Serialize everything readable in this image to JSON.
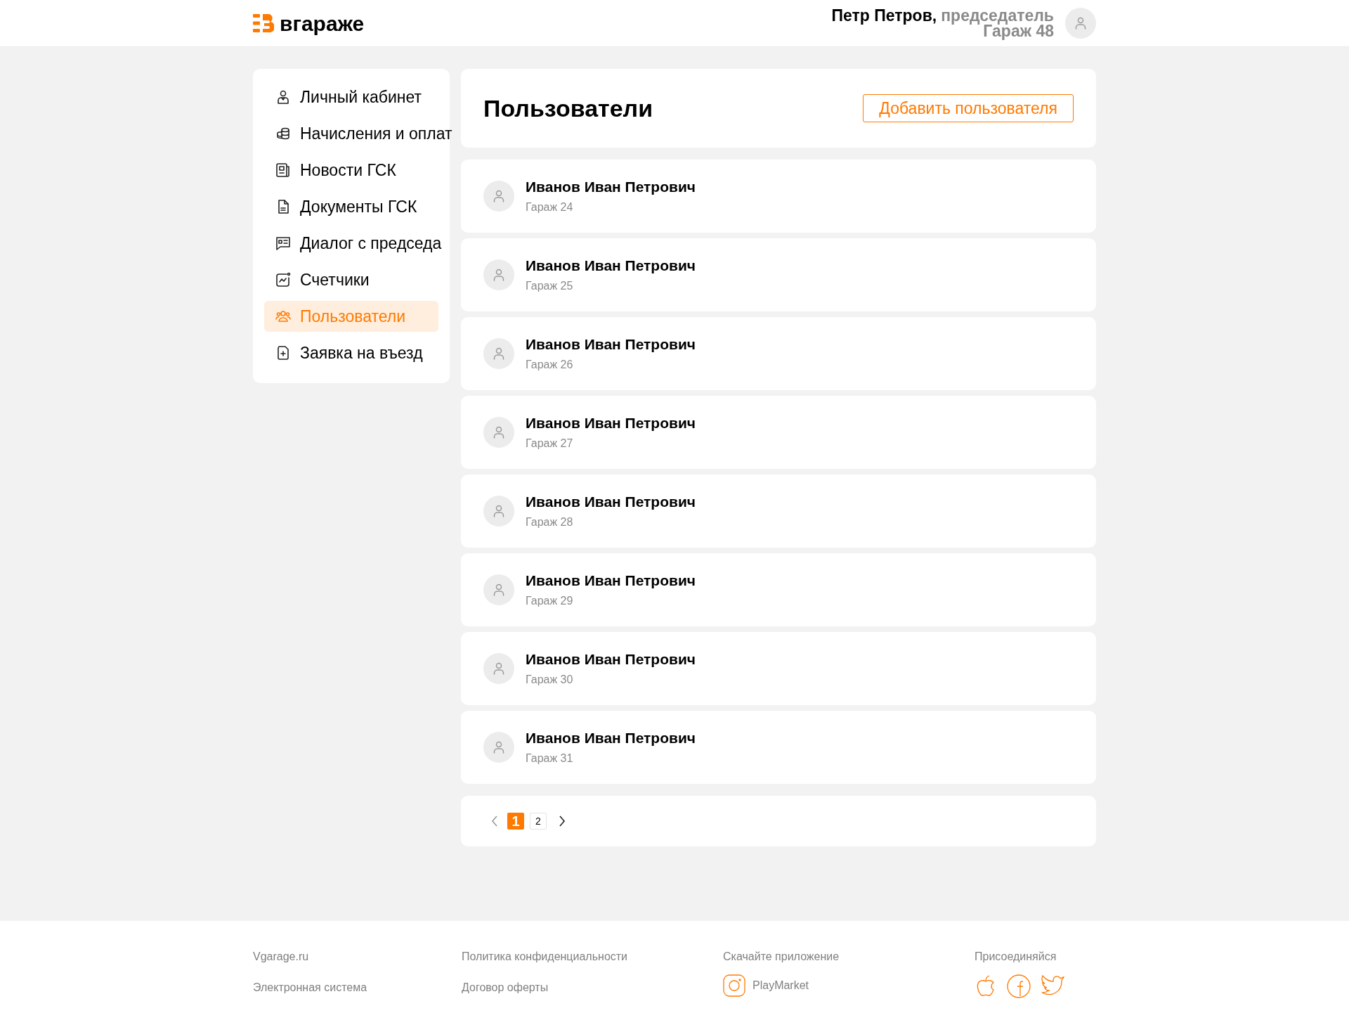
{
  "header": {
    "logo_text": "вгараже",
    "user_name": "Петр Петров,",
    "user_role": "председатель",
    "user_garage": "Гараж 48"
  },
  "sidebar": {
    "items": [
      {
        "label": "Личный кабинет",
        "kind": "user",
        "selected": false
      },
      {
        "label": "Начисления и оплат",
        "kind": "coins",
        "selected": false
      },
      {
        "label": "Новости ГСК",
        "kind": "news",
        "selected": false
      },
      {
        "label": "Документы ГСК",
        "kind": "doc",
        "selected": false
      },
      {
        "label": "Диалог с председа",
        "kind": "chat",
        "selected": false
      },
      {
        "label": "Счетчики",
        "kind": "chart",
        "selected": false
      },
      {
        "label": "Пользователи",
        "kind": "users",
        "selected": true
      },
      {
        "label": "Заявка на въезд",
        "kind": "request",
        "selected": false
      }
    ]
  },
  "page": {
    "title": "Пользователи",
    "add_button": "Добавить пользователя"
  },
  "users": [
    {
      "name": "Иванов Иван Петрович",
      "garage": "Гараж 24"
    },
    {
      "name": "Иванов Иван Петрович",
      "garage": "Гараж 25"
    },
    {
      "name": "Иванов Иван Петрович",
      "garage": "Гараж 26"
    },
    {
      "name": "Иванов Иван Петрович",
      "garage": "Гараж 27"
    },
    {
      "name": "Иванов Иван Петрович",
      "garage": "Гараж 28"
    },
    {
      "name": "Иванов Иван Петрович",
      "garage": "Гараж 29"
    },
    {
      "name": "Иванов Иван Петрович",
      "garage": "Гараж 30"
    },
    {
      "name": "Иванов Иван Петрович",
      "garage": "Гараж 31"
    }
  ],
  "pagination": {
    "pages": [
      {
        "label": "1",
        "selected": true
      },
      {
        "label": "2",
        "selected": false
      }
    ],
    "prev_disabled": true
  },
  "footer": {
    "columns": [
      {
        "kind": "text",
        "items": [
          "Vgarage.ru",
          "Электронная система"
        ]
      },
      {
        "kind": "links",
        "items": [
          "Политика конфиденциальности",
          "Договор оферты"
        ]
      },
      {
        "kind": "app",
        "title": "Скачайте приложение",
        "store": "PlayMarket"
      },
      {
        "kind": "social",
        "title": "Присоединяйся"
      }
    ]
  }
}
